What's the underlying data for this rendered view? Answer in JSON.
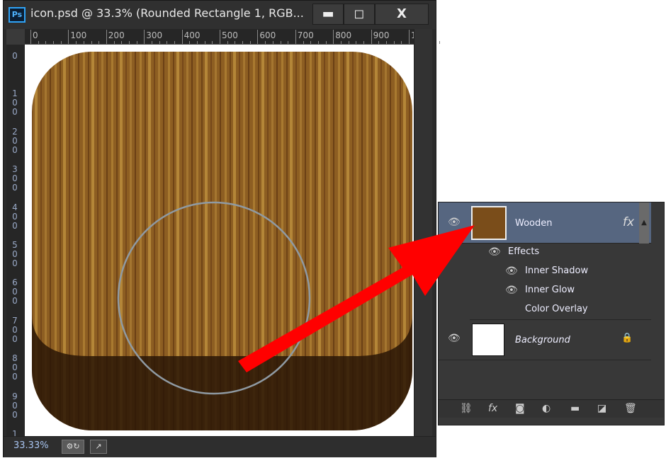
{
  "window": {
    "app_badge": "Ps",
    "title": "icon.psd @ 33.3% (Rounded Rectangle 1, RGB...",
    "minimize": "▬",
    "maximize": "◻",
    "close": "X"
  },
  "ruler": {
    "top": [
      "0",
      "100",
      "200",
      "300",
      "400",
      "500",
      "600",
      "700",
      "800",
      "900",
      "1"
    ],
    "left": [
      "0",
      "100",
      "200",
      "300",
      "400",
      "500",
      "600",
      "700",
      "800",
      "900",
      "1"
    ]
  },
  "status": {
    "zoom": "33.33%"
  },
  "layers": {
    "items": [
      {
        "name": "Wooden",
        "fx": "fx",
        "selected": true
      },
      {
        "name": "Background",
        "locked": true
      }
    ],
    "effects_label": "Effects",
    "effects": [
      "Inner Shadow",
      "Inner Glow",
      "Color Overlay"
    ],
    "toolbar": [
      "link-icon",
      "fx-icon",
      "mask-icon",
      "adjustment-icon",
      "folder-icon",
      "new-layer-icon",
      "trash-icon"
    ]
  },
  "colors": {
    "selected_layer": "#566680",
    "arrow": "#ff0000",
    "wood": "#8a5a1e"
  }
}
